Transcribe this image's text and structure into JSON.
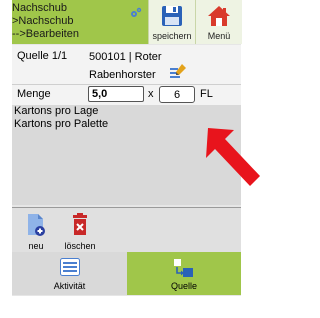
{
  "header": {
    "breadcrumb": [
      "Nachschub",
      ">Nachschub",
      "-->Bearbeiten"
    ],
    "save_label": "speichern",
    "menu_label": "Menü"
  },
  "quelle": {
    "label": "Quelle 1/1",
    "value": "500101 | Roter Rabenhorster"
  },
  "menge": {
    "label": "Menge",
    "value": "5,0",
    "times": "x",
    "count": "6",
    "unit": "FL"
  },
  "info": {
    "lines": [
      "Kartons pro Lage",
      "Kartons pro Palette"
    ]
  },
  "actions": {
    "new_label": "neu",
    "delete_label": "löschen"
  },
  "tabs": {
    "aktivitaet": "Aktivität",
    "quelle": "Quelle"
  },
  "colors": {
    "accent": "#a0c64a",
    "arrow": "#e8141c"
  },
  "icons": [
    "gear-icon",
    "save-icon",
    "home-icon",
    "edit-icon",
    "new-document-icon",
    "trash-icon",
    "list-icon",
    "transfer-icon",
    "arrow-icon"
  ]
}
